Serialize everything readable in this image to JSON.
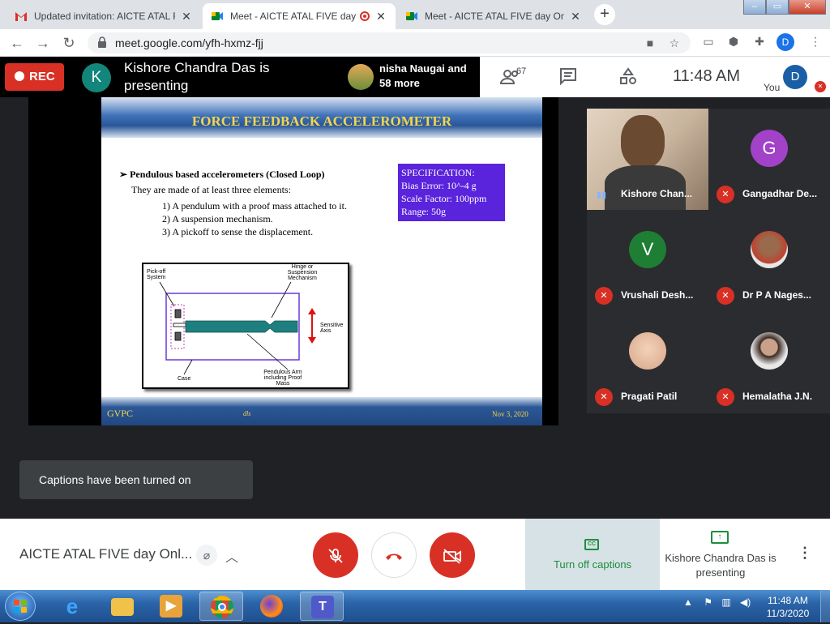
{
  "browser": {
    "tabs": [
      {
        "title": "Updated invitation: AICTE ATAL F",
        "icon": "gmail-icon",
        "active": false
      },
      {
        "title": "Meet - AICTE ATAL FIVE day",
        "icon": "meet-icon",
        "active": true,
        "recording": true
      },
      {
        "title": "Meet - AICTE ATAL FIVE day Onli",
        "icon": "meet-icon",
        "active": false
      }
    ],
    "new_tab": "+",
    "window_controls": [
      "–",
      "▭",
      "✕"
    ],
    "url": "meet.google.com/yfh-hxmz-fjj",
    "profile_initial": "D"
  },
  "meet": {
    "rec_label": "REC",
    "presenter_initial": "K",
    "presenter_text": "Kishore Chandra Das is presenting",
    "others_text": "nisha Naugai and 58 more",
    "participant_count": "67",
    "time": "11:48  AM",
    "you_label": "You",
    "you_initial": "D"
  },
  "slide": {
    "title": "FORCE FEEDBACK ACCELEROMETER",
    "heading": "Pendulous based accelerometers (Closed Loop)",
    "intro": "They are made of at least three elements:",
    "items": [
      "1) A pendulum with a proof mass attached to it.",
      "2) A suspension mechanism.",
      "3) A pickoff to sense the displacement."
    ],
    "spec": [
      "SPECIFICATION:",
      "Bias Error: 10^-4 g",
      "Scale Factor: 100ppm",
      "Range: 50g"
    ],
    "diagram_labels": {
      "pickoff": "Pick-off System",
      "hinge": "Hinge or Suspension Mechanism",
      "axis": "Sensitive Axis",
      "case": "Case",
      "arm": "Pendulous Arm including Proof Mass"
    },
    "footer_left": "GVPC",
    "footer_mid": "dls",
    "footer_right": "Nov 3, 2020"
  },
  "participants": [
    {
      "name": "Kishore Chan...",
      "type": "video",
      "speaking": true
    },
    {
      "name": "Gangadhar De...",
      "initial": "G",
      "color": "#a142c9",
      "muted": true
    },
    {
      "name": "Vrushali Desh...",
      "initial": "V",
      "color": "#1e7e34",
      "muted": true
    },
    {
      "name": "Dr P A Nages...",
      "type": "photo",
      "muted": true
    },
    {
      "name": "Pragati Patil",
      "type": "photo",
      "muted": true
    },
    {
      "name": "Hemalatha J.N.",
      "type": "photo",
      "muted": true
    }
  ],
  "toast": "Captions have been turned on",
  "bottom": {
    "meeting_title": "AICTE ATAL FIVE day Onl...",
    "captions_label": "Turn off captions",
    "cc": "CC",
    "presenting_label": "Kishore Chandra Das is presenting"
  },
  "taskbar": {
    "time": "11:48 AM",
    "date": "11/3/2020"
  }
}
